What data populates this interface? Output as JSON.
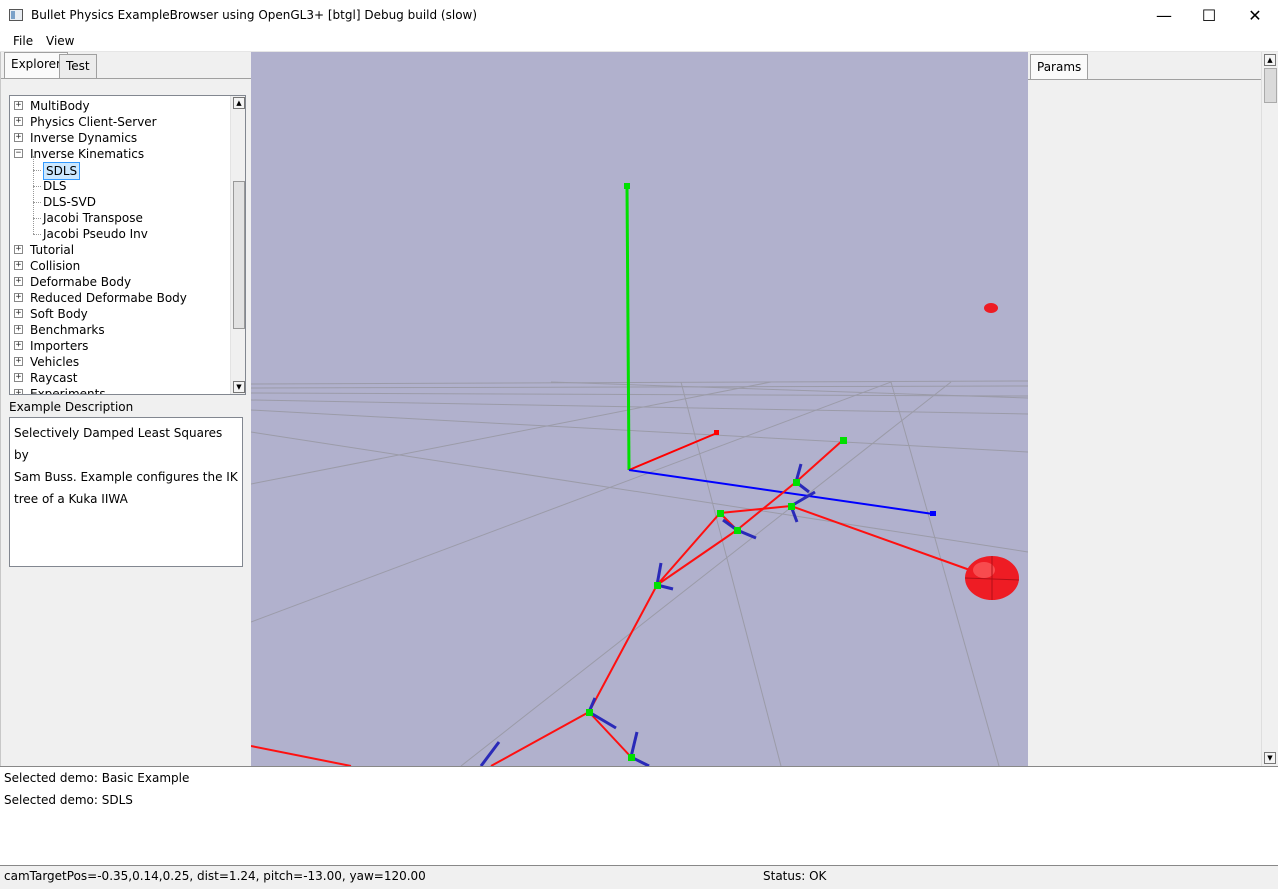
{
  "window": {
    "title": "Bullet Physics ExampleBrowser using OpenGL3+ [btgl] Debug build (slow)",
    "minimize_glyph": "—",
    "maximize_glyph": "☐",
    "close_glyph": "✕"
  },
  "menu": {
    "file": "File",
    "view": "View"
  },
  "left_tabs": {
    "explorer": "Explorer",
    "test": "Test"
  },
  "tree": {
    "top_items": [
      "MultiBody",
      "Physics Client-Server",
      "Inverse Dynamics",
      "Inverse Kinematics"
    ],
    "ik_children": [
      "SDLS",
      "DLS",
      "DLS-SVD",
      "Jacobi Transpose",
      "Jacobi Pseudo Inv"
    ],
    "bottom_items": [
      "Tutorial",
      "Collision",
      "Deformabe Body",
      "Reduced Deformabe Body",
      "Soft Body",
      "Benchmarks",
      "Importers",
      "Vehicles",
      "Raycast",
      "Experiments"
    ],
    "selected": "SDLS",
    "expand_plus": "+",
    "expand_minus": "−"
  },
  "description": {
    "label": "Example Description",
    "lines": [
      "Selectively Damped Least Squares by",
      "Sam Buss. Example configures the IK",
      "tree of a Kuka IIWA"
    ]
  },
  "right_panel": {
    "tab": "Params"
  },
  "console": {
    "lines": [
      "Selected demo: Basic Example",
      "Selected demo: SDLS"
    ]
  },
  "status": {
    "camera": "camTargetPos=-0.35,0.14,0.25, dist=1.24, pitch=-13.00, yaw=120.00",
    "state": "Status: OK"
  },
  "colors": {
    "viewport_bg": "#b1b1cd",
    "axis_x": "#ff0000",
    "axis_y": "#00e000",
    "axis_z": "#0000ff",
    "link": "#ff1010",
    "target": "#ee1c24"
  }
}
